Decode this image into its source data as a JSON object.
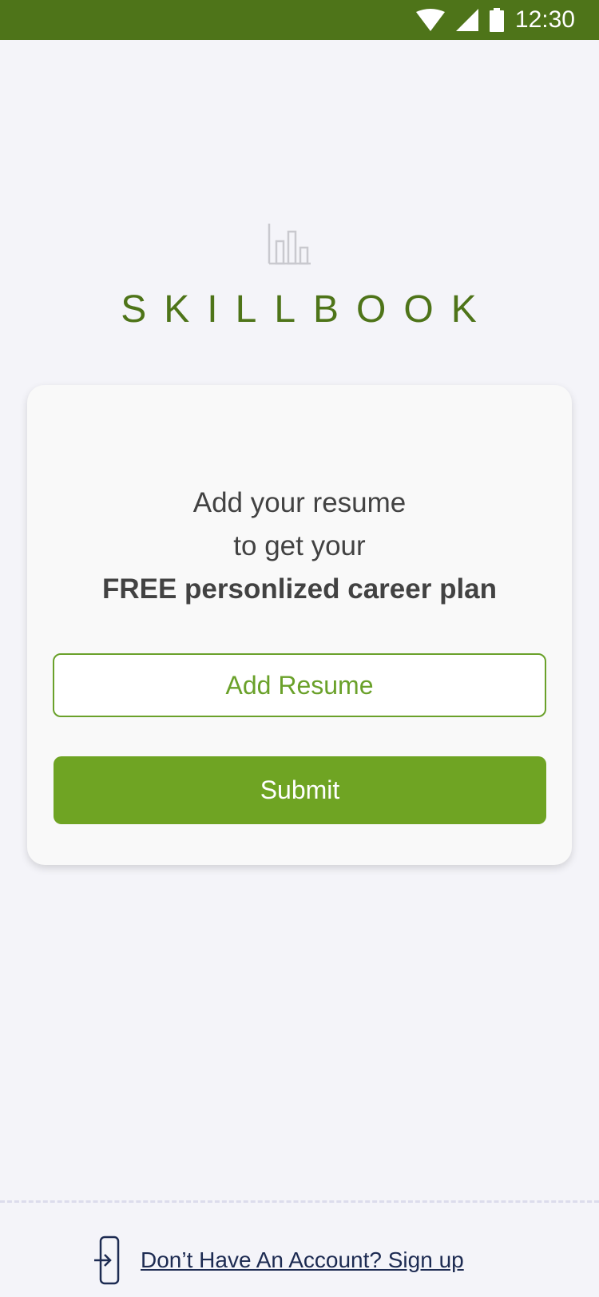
{
  "status_bar": {
    "time": "12:30",
    "icons": [
      "wifi-icon",
      "signal-icon",
      "battery-icon"
    ]
  },
  "brand": {
    "logo_icon": "bar-chart-icon",
    "name": "SKILLBOOK"
  },
  "card": {
    "line1": "Add your resume",
    "line2": "to get your",
    "line3": "FREE personlized career plan",
    "add_resume_label": "Add Resume",
    "submit_label": "Submit"
  },
  "footer": {
    "signup_icon": "login-icon",
    "signup_text": "Don’t Have An Account? Sign up"
  },
  "colors": {
    "status_bar": "#4e7419",
    "brand": "#4e7419",
    "accent": "#6fa423",
    "background": "#f4f4f9",
    "link": "#1d2b52"
  }
}
